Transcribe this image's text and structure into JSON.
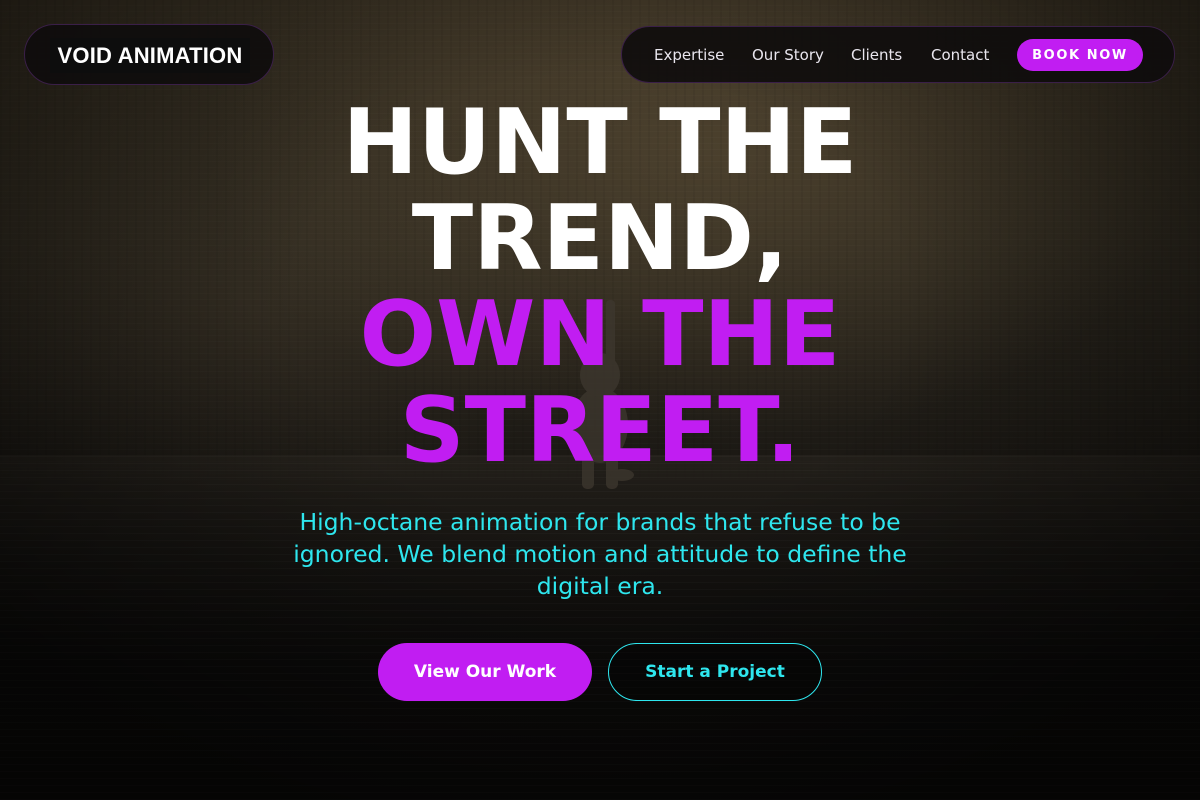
{
  "brand": {
    "name": "VOID ANIMATION"
  },
  "nav": {
    "items": [
      {
        "label": "Expertise"
      },
      {
        "label": "Our Story"
      },
      {
        "label": "Clients"
      },
      {
        "label": "Contact"
      }
    ],
    "cta_label": "BOOK NOW"
  },
  "hero": {
    "headline_lines": [
      "HUNT THE",
      "TREND,",
      "OWN THE",
      "STREET."
    ],
    "subtitle": "High-octane animation for brands that refuse to be ignored. We blend motion and attitude to define the digital era.",
    "primary_button": "View Our Work",
    "secondary_button": "Start a Project"
  },
  "colors": {
    "accent": "#c11df2",
    "secondary": "#2ee6ee",
    "headline": "#ffffff",
    "background": "#0c0b0a"
  }
}
